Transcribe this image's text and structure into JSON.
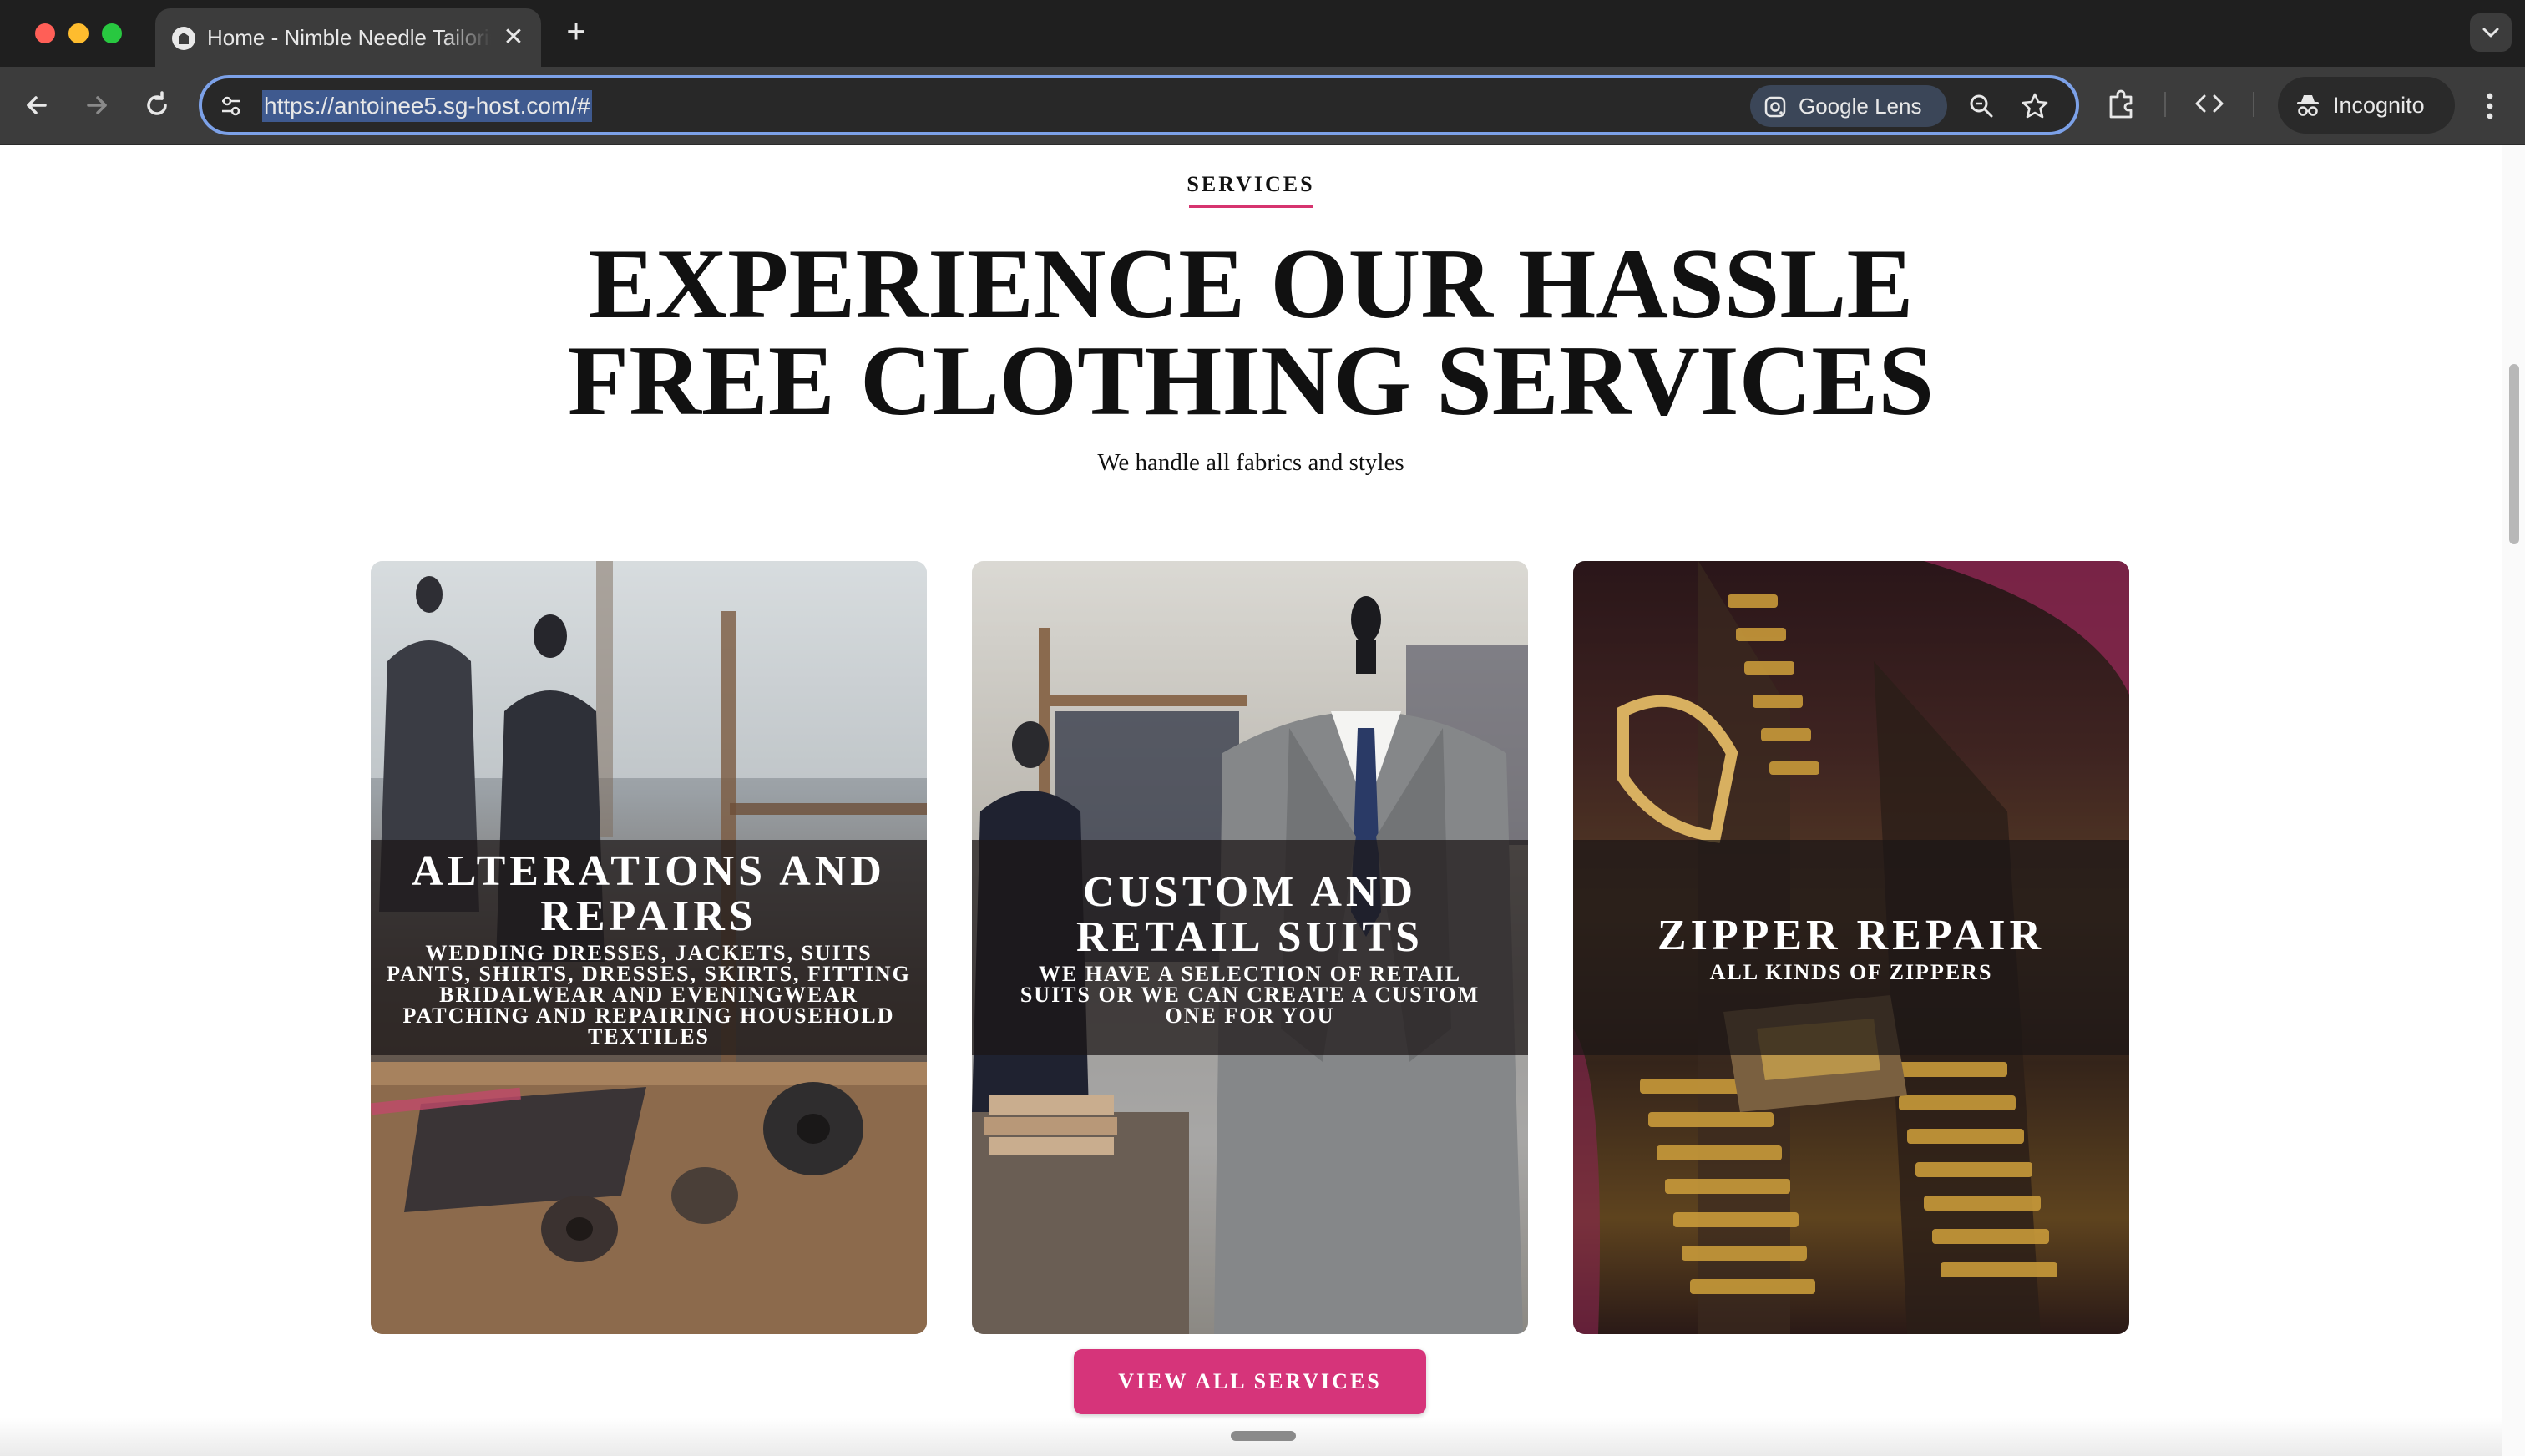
{
  "browser": {
    "tab_title": "Home - Nimble Needle Tailoring",
    "url": "https://antoinee5.sg-host.com/#",
    "lens_label": "Google Lens",
    "profile_label": "Incognito"
  },
  "page": {
    "eyebrow": "SERVICES",
    "headline_line1": "EXPERIENCE OUR HASSLE",
    "headline_line2": "FREE CLOTHING SERVICES",
    "subhead": "We handle all fabrics and styles",
    "cards": [
      {
        "title_line1": "ALTERATIONS AND",
        "title_line2": "REPAIRS",
        "desc_line1": "WEDDING DRESSES, JACKETS, SUITS",
        "desc_line2": "PANTS, SHIRTS, DRESSES, SKIRTS, FITTING",
        "desc_line3": "BRIDALWEAR AND EVENINGWEAR",
        "desc_line4": "PATCHING AND REPAIRING HOUSEHOLD",
        "desc_line5": "TEXTILES"
      },
      {
        "title_line1": "CUSTOM AND",
        "title_line2": "RETAIL SUITS",
        "desc_line1": "WE HAVE A SELECTION OF RETAIL",
        "desc_line2": "SUITS OR WE CAN CREATE A CUSTOM",
        "desc_line3": "ONE FOR YOU"
      },
      {
        "title_line1": "ZIPPER REPAIR",
        "desc_line1": "ALL KINDS OF ZIPPERS"
      }
    ],
    "cta_label": "VIEW ALL SERVICES"
  },
  "colors": {
    "accent": "#d6347a",
    "omnibox_focus": "#7ca1e8",
    "chrome_dark": "#1f1f1f"
  },
  "icons": [
    "site-favicon-icon",
    "close-icon",
    "plus-icon",
    "chevron-down-icon",
    "back-arrow-icon",
    "forward-arrow-icon",
    "reload-icon",
    "site-settings-icon",
    "google-lens-icon",
    "zoom-icon",
    "bookmark-star-icon",
    "extensions-icon",
    "devtools-icon",
    "incognito-icon",
    "more-vert-icon"
  ]
}
